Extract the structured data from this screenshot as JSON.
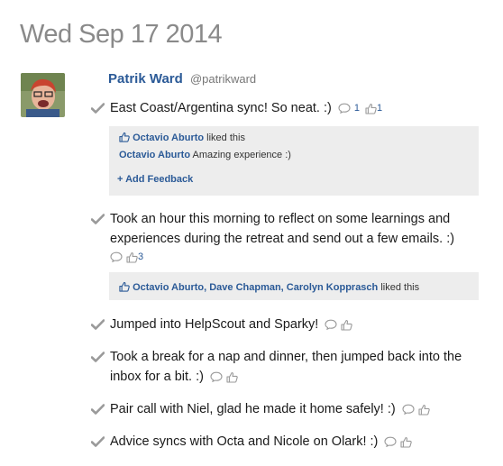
{
  "date": "Wed Sep 17 2014",
  "author": {
    "name": "Patrik Ward",
    "handle": "@patrikward"
  },
  "updates": [
    {
      "text": "East Coast/Argentina sync! So neat. :)",
      "comment_count": "1",
      "like_count": "1"
    },
    {
      "text": "Took an hour this morning to reflect on some learnings and experiences during the retreat and send out a few emails. :)",
      "comment_count": "",
      "like_count": "3"
    },
    {
      "text": "Jumped into HelpScout and Sparky!"
    },
    {
      "text": "Took a break for a nap and dinner, then jumped back into the inbox for a bit. :)"
    },
    {
      "text": "Pair call with Niel, glad he made it home safely! :)"
    },
    {
      "text": "Advice syncs with Octa and Nicole on Olark! :)"
    }
  ],
  "feedback1": {
    "liker": "Octavio Aburto",
    "liked_text": "liked this",
    "comment_author": "Octavio Aburto",
    "comment_text": "Amazing experience :)",
    "add_feedback": "+ Add Feedback"
  },
  "feedback2": {
    "likers": "Octavio Aburto, Dave Chapman, Carolyn Kopprasch",
    "liked_text": "liked this"
  },
  "icons": {
    "check": "checkmark-icon",
    "comment": "comment-bubble-icon",
    "like": "thumbs-up-icon"
  },
  "colors": {
    "link": "#2b5a97",
    "date": "#8a8a8a",
    "panel": "#ededed"
  }
}
